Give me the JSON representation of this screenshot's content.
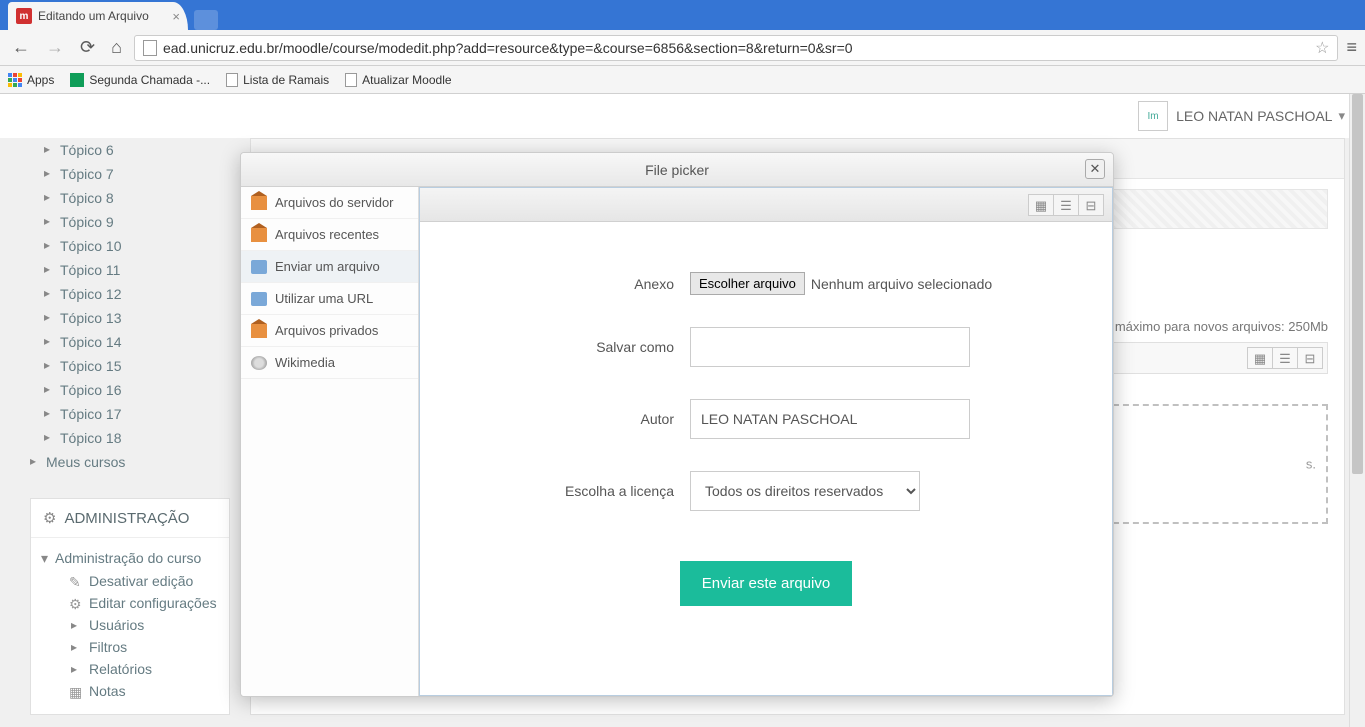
{
  "browser": {
    "tab_title": "Editando um Arquivo",
    "url": "ead.unicruz.edu.br/moodle/course/modedit.php?add=resource&type=&course=6856&section=8&return=0&sr=0"
  },
  "bookmarks": {
    "apps": "Apps",
    "items": [
      "Segunda Chamada -...",
      "Lista de Ramais",
      "Atualizar Moodle"
    ]
  },
  "user": {
    "name": "LEO NATAN PASCHOAL",
    "avatar_alt": "Im"
  },
  "sidebar": {
    "topics": [
      "Tópico 6",
      "Tópico 7",
      "Tópico 8",
      "Tópico 9",
      "Tópico 10",
      "Tópico 11",
      "Tópico 12",
      "Tópico 13",
      "Tópico 14",
      "Tópico 15",
      "Tópico 16",
      "Tópico 17",
      "Tópico 18"
    ],
    "meus_cursos": "Meus cursos"
  },
  "admin": {
    "title": "ADMINISTRAÇÃO",
    "root": "Administração do curso",
    "items": [
      "Desativar edição",
      "Editar configurações",
      "Usuários",
      "Filtros",
      "Relatórios",
      "Notas"
    ]
  },
  "main": {
    "hint_prefix": "o máximo para novos arquivos: ",
    "hint_value": "250Mb",
    "dropzone_msg": "s."
  },
  "dialog": {
    "title": "File picker",
    "repos": [
      "Arquivos do servidor",
      "Arquivos recentes",
      "Enviar um arquivo",
      "Utilizar uma URL",
      "Arquivos privados",
      "Wikimedia"
    ],
    "form": {
      "attach_label": "Anexo",
      "choose_btn": "Escolher arquivo",
      "no_file": "Nenhum arquivo selecionado",
      "saveas_label": "Salvar como",
      "saveas_value": "",
      "author_label": "Autor",
      "author_value": "LEO NATAN PASCHOAL",
      "license_label": "Escolha a licença",
      "license_value": "Todos os direitos reservados",
      "submit": "Enviar este arquivo"
    }
  }
}
